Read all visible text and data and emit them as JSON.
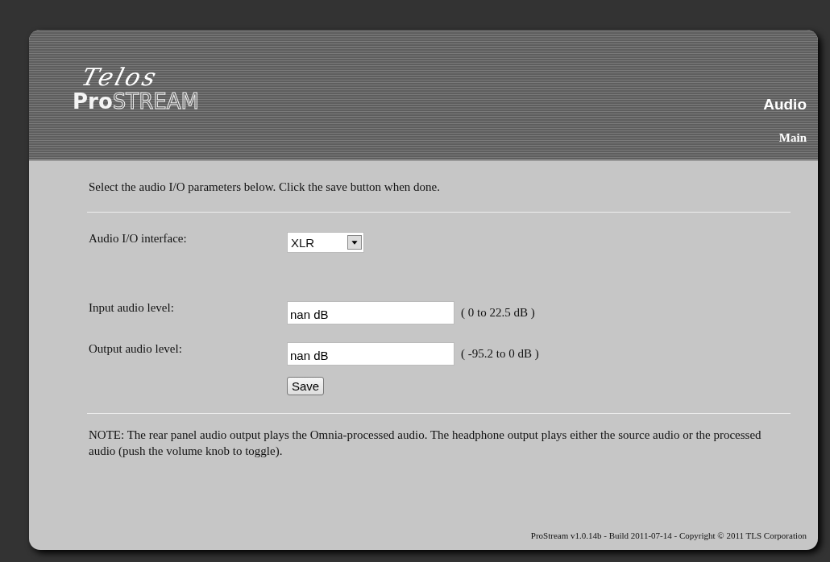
{
  "header": {
    "logo_script": "Telos",
    "logo": "**Pro**STREAM",
    "page_title": "Audio",
    "nav_link": "Main"
  },
  "intro": "Select the audio I/O parameters below. Click the save button when done.",
  "fields": [
    {
      "kind": "select",
      "label": "Audio I/O interface:",
      "value": "XLR"
    },
    {
      "kind": "text",
      "label": "Input audio level:",
      "value": "nan dB",
      "range": "( 0 to 22.5 dB )"
    },
    {
      "kind": "text",
      "label": "Output audio level:",
      "value": "nan dB",
      "range": "( -95.2 to 0 dB )"
    }
  ],
  "save_button": "Save",
  "note": "NOTE: The rear panel audio output plays the Omnia-processed audio. The headphone output plays either the source audio or the processed audio (push the volume knob to toggle).",
  "footer": "ProStream v1.0.14b - Build 2011-07-14 - Copyright © 2011 TLS Corporation"
}
